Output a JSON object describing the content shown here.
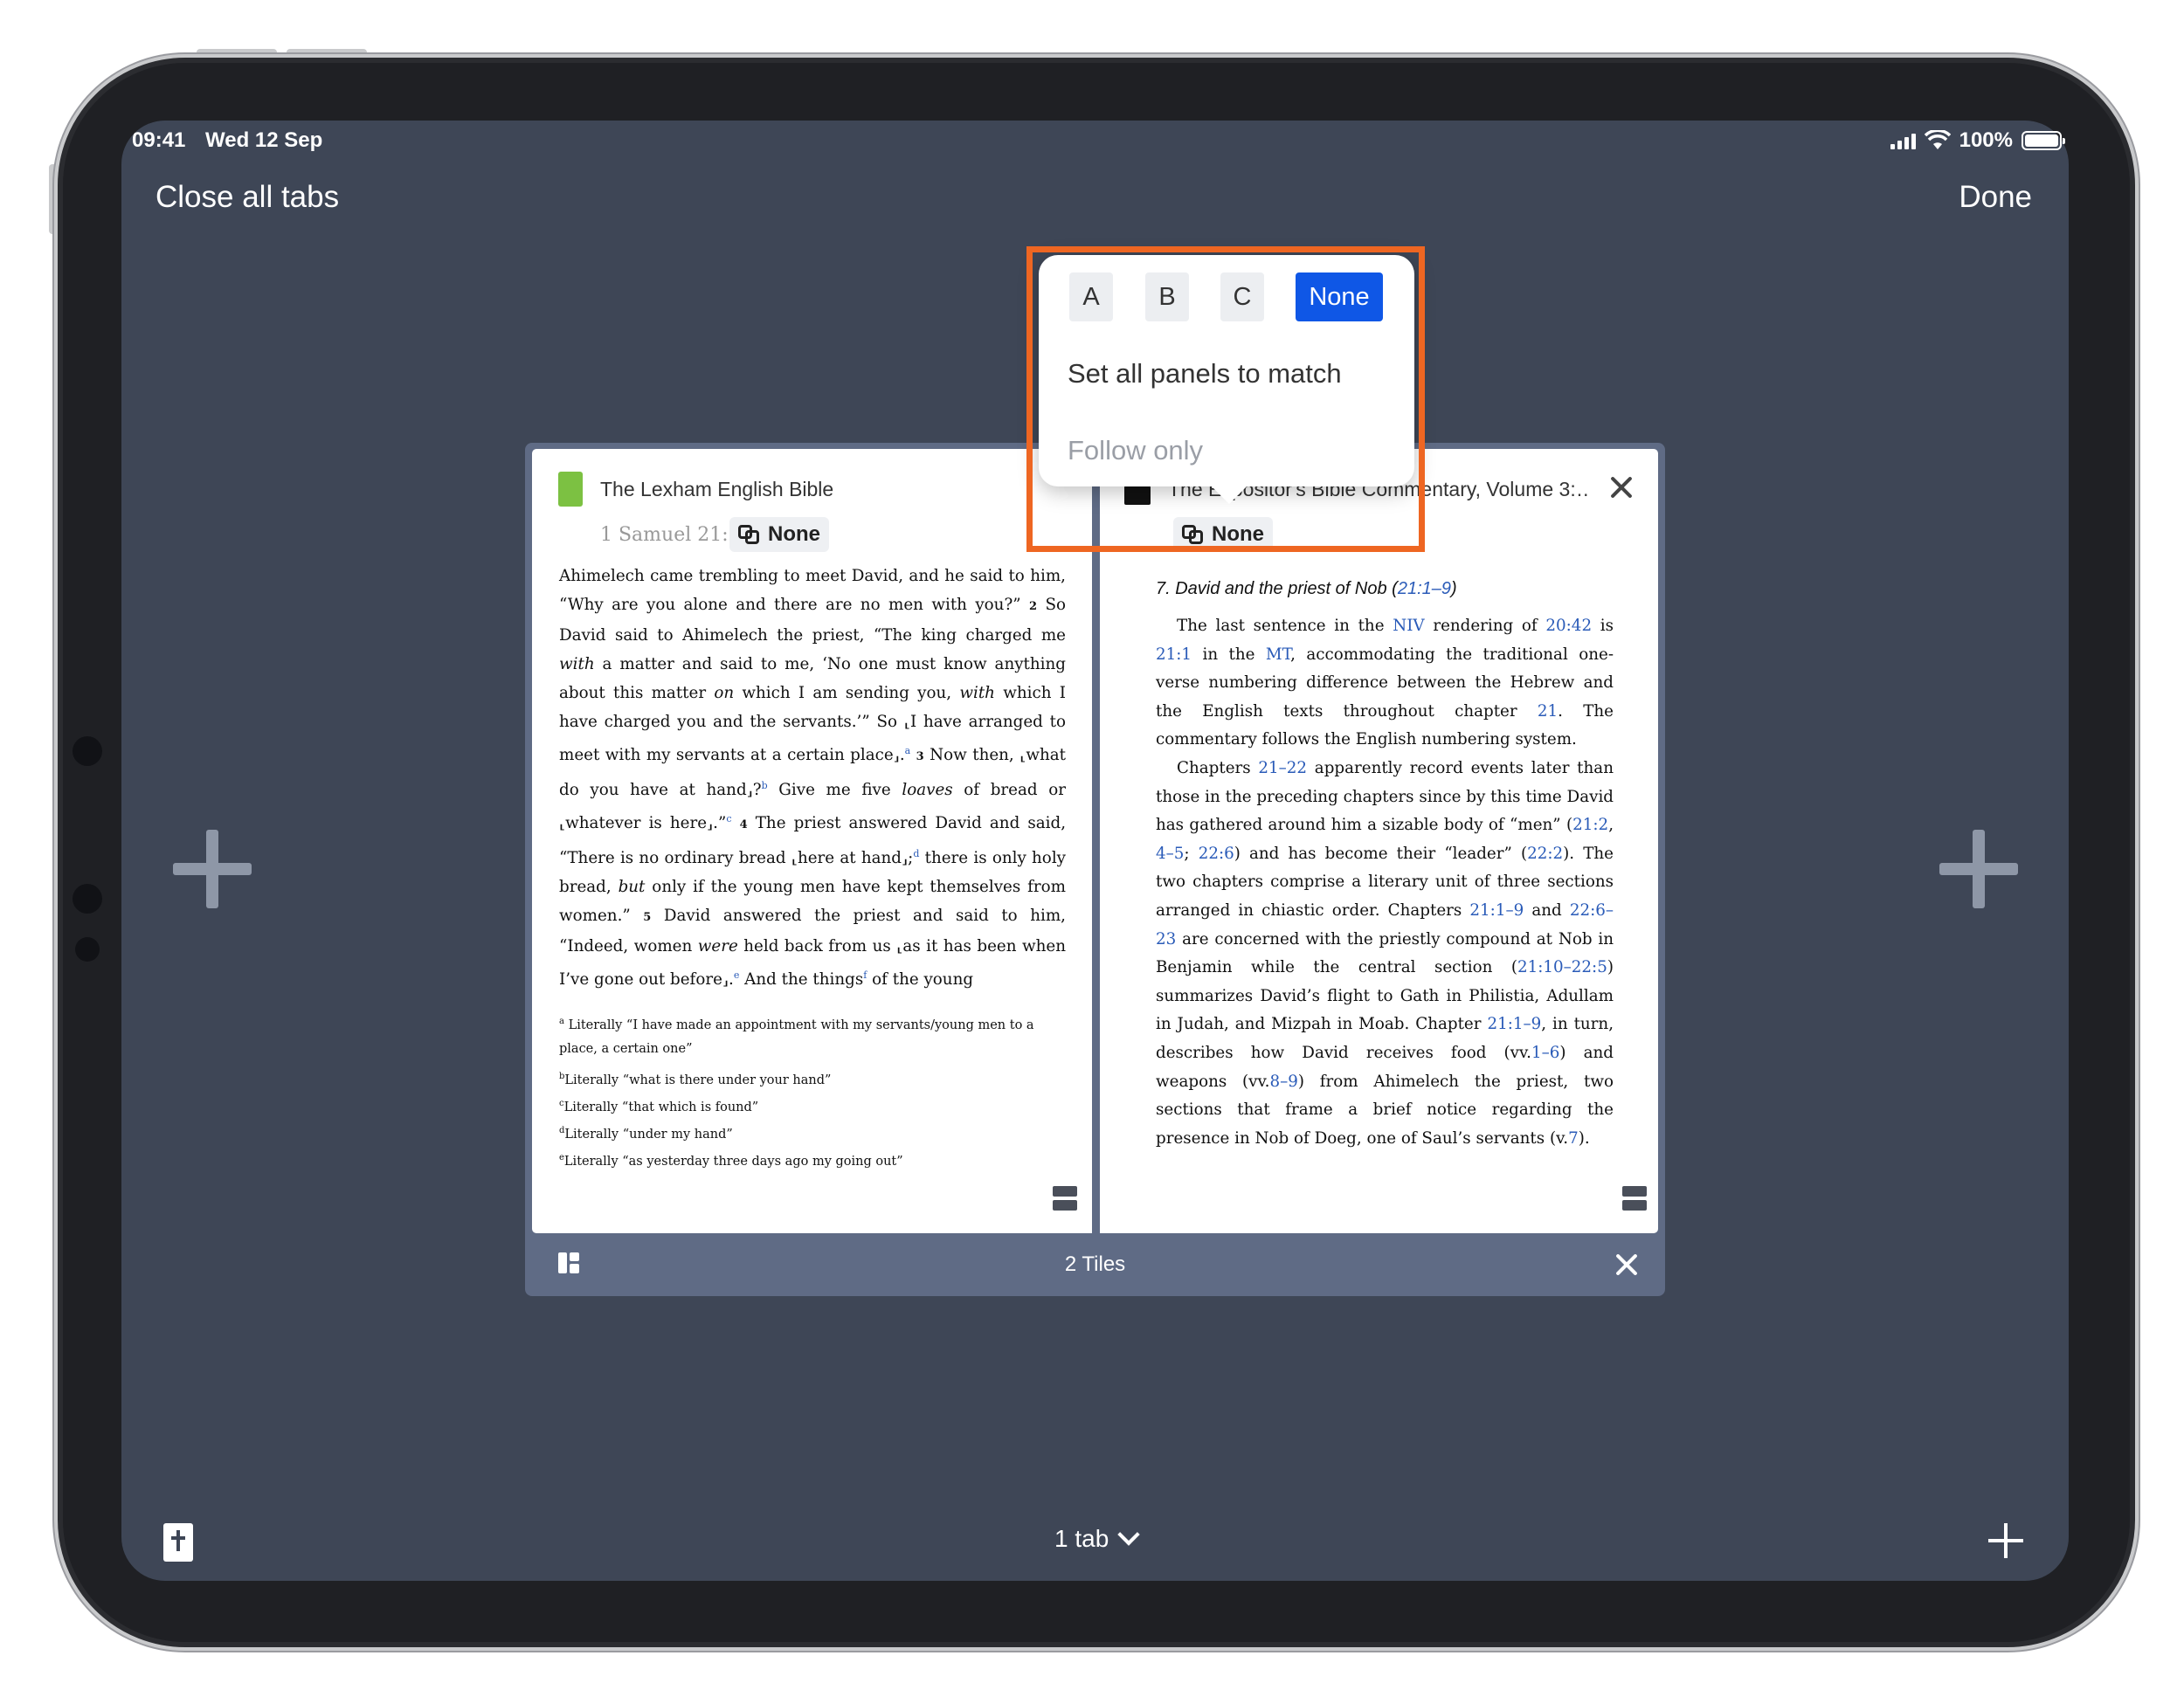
{
  "status_bar": {
    "time": "09:41",
    "date": "Wed 12 Sep",
    "battery": "100%"
  },
  "nav": {
    "close_all": "Close all tabs",
    "done": "Done"
  },
  "card": {
    "tiles_label": "2 Tiles",
    "left_panel": {
      "title": "The Lexham English Bible",
      "reference": "1 Samuel 21:1",
      "link_set": "None",
      "footnotes": [
        "Literally “I have made an appointment with my servants/young men to a",
        "place, a certain one”",
        "Literally “what is there under your hand”",
        "Literally “that which is found”",
        "Literally “under my hand”",
        "Literally “as yesterday three days ago my going out”"
      ],
      "footnote_marks": [
        "a",
        "",
        "b",
        "c",
        "d",
        "e"
      ]
    },
    "right_panel": {
      "title": "The Expositor's Bible Commentary, Volume 3:…",
      "link_set": "None",
      "heading": "7. David and the priest of Nob (",
      "heading_ref": "21:1–9",
      "heading_end": ")"
    }
  },
  "popover": {
    "segments": [
      "A",
      "B",
      "C",
      "None"
    ],
    "active_segment": "None",
    "set_all": "Set all panels to match",
    "follow_only": "Follow only"
  },
  "bottom": {
    "tab_count": "1 tab"
  }
}
